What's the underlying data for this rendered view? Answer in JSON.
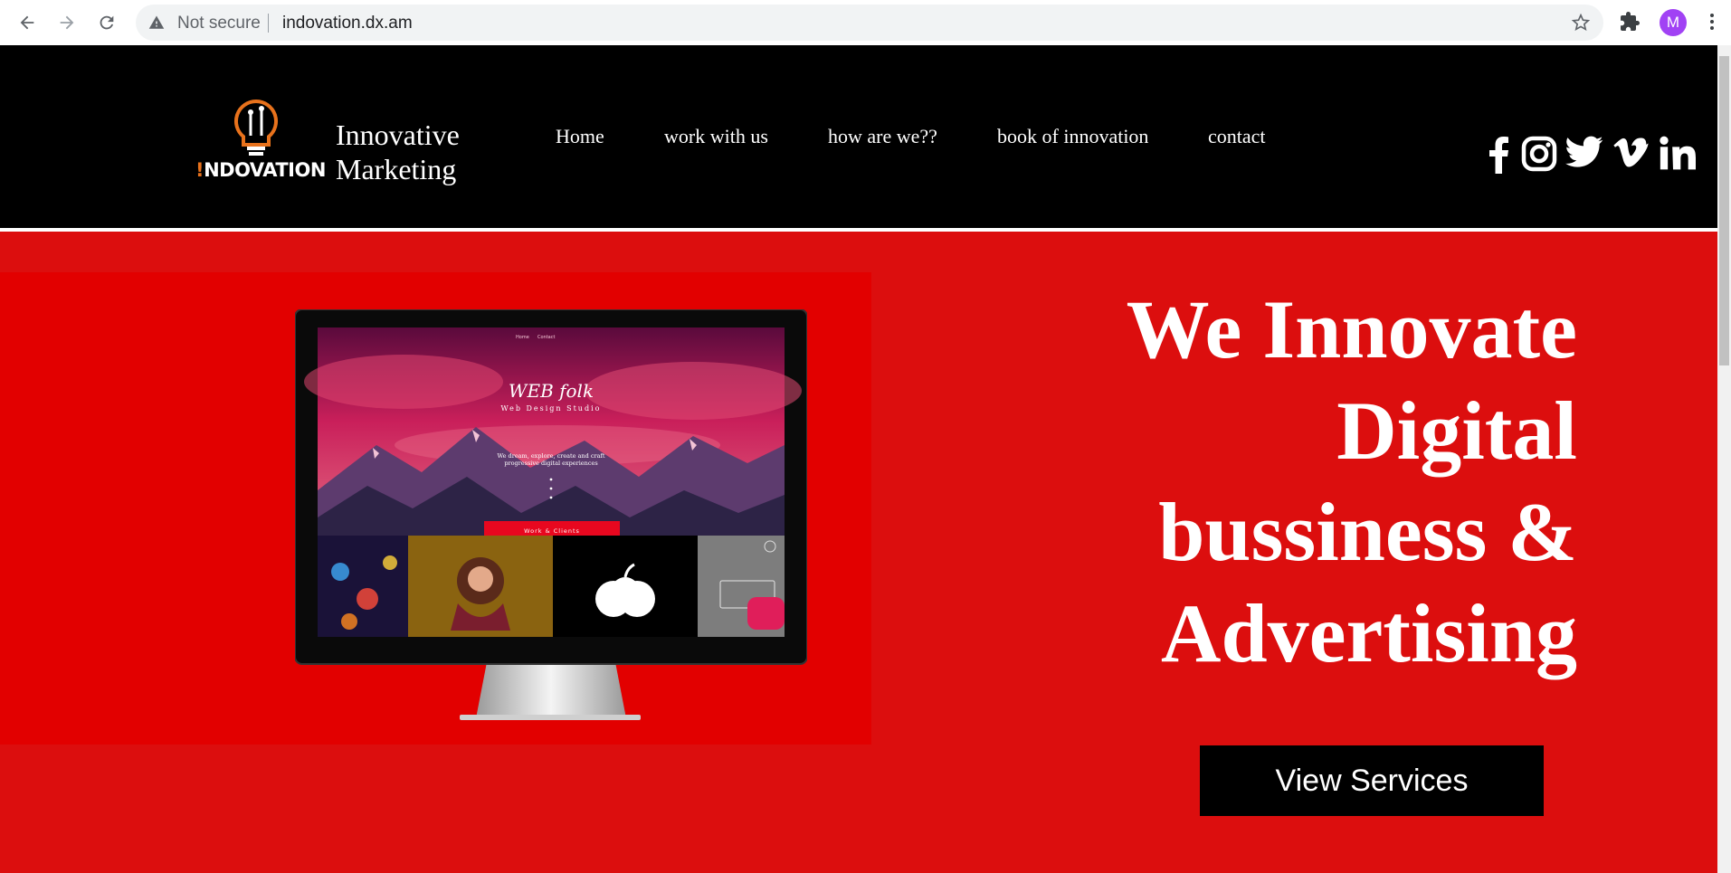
{
  "browser": {
    "security_label": "Not secure",
    "url": "indovation.dx.am",
    "profile_initial": "M"
  },
  "header": {
    "logo_text_i": "!",
    "logo_text_rest": "NDOVATION",
    "brand_line1": "Innovative",
    "brand_line2": "Marketing",
    "nav": [
      "Home",
      "work with us",
      "how are we??",
      "book of innovation",
      "contact"
    ],
    "social_icons": [
      "facebook-icon",
      "instagram-icon",
      "twitter-icon",
      "vimeo-icon",
      "linkedin-icon"
    ]
  },
  "hero": {
    "headline": [
      "We Innovate",
      "Digital",
      "bussiness &",
      "Advertising"
    ],
    "cta": "View Services",
    "screen": {
      "nav": [
        "Home",
        "Contact"
      ],
      "title": "WEB folk",
      "subtitle": "Web Design Studio",
      "tagline_line1": "We dream, explore, create and craft",
      "tagline_line2": "progressive digital experiences",
      "button": "Work & Clients"
    }
  },
  "colors": {
    "header_bg": "#000000",
    "hero_bg": "#dc0e0e",
    "accent_orange": "#e8721c",
    "cta_bg": "#000000"
  }
}
